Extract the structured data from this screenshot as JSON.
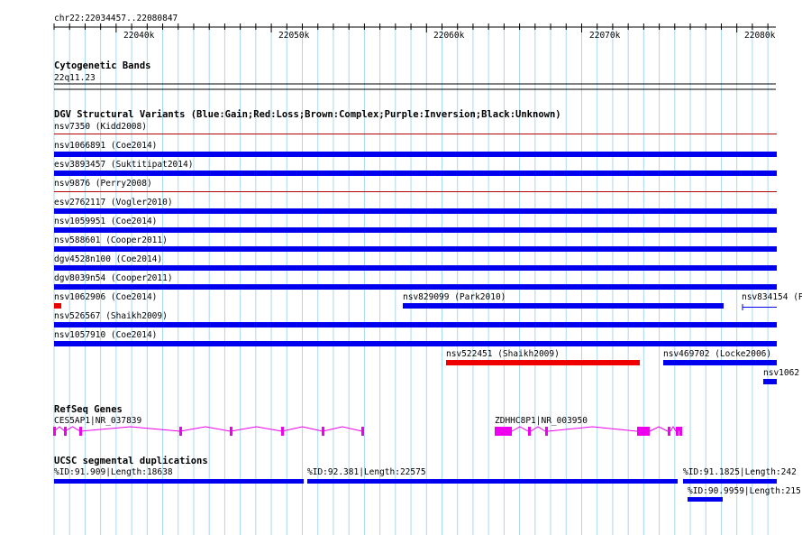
{
  "region": "chr22:22034457..22080847",
  "ruler": {
    "ticks": [
      "22040k",
      "22050k",
      "22060k",
      "22070k",
      "22080k"
    ]
  },
  "colors": {
    "gain": "#0000ee",
    "loss": "#ee0000",
    "refseq": "#ee00ee",
    "segdup": "#0000ee",
    "gridline": "#a8d8ee"
  },
  "tracks": {
    "cyto": {
      "title": "Cytogenetic Bands",
      "band": "22q11.23"
    },
    "dgv": {
      "title": "DGV Structural Variants (Blue:Gain;Red:Loss;Brown:Complex;Purple:Inversion;Black:Unknown)",
      "features": [
        {
          "label": "nsv7350 (Kidd2008)",
          "type": "gain",
          "style": "line"
        },
        {
          "label": "nsv1066891 (Coe2014)",
          "type": "gain",
          "style": "bar"
        },
        {
          "label": "esv3893457 (Suktitipat2014)",
          "type": "gain",
          "style": "bar"
        },
        {
          "label": "nsv9876 (Perry2008)",
          "type": "gain",
          "style": "line"
        },
        {
          "label": "esv2762117 (Vogler2010)",
          "type": "gain",
          "style": "bar"
        },
        {
          "label": "nsv1059951 (Coe2014)",
          "type": "gain",
          "style": "bar"
        },
        {
          "label": "nsv588601 (Cooper2011)",
          "type": "gain",
          "style": "bar"
        },
        {
          "label": "dgv4528n100 (Coe2014)",
          "type": "gain",
          "style": "bar"
        },
        {
          "label": "dgv8039n54 (Cooper2011)",
          "type": "gain",
          "style": "bar"
        },
        {
          "label": "nsv1062906 (Coe2014)",
          "type": "loss",
          "style": "bar"
        },
        {
          "label": "nsv829099 (Park2010)",
          "type": "gain",
          "style": "bar"
        },
        {
          "label": "nsv834154 (P",
          "type": "gain",
          "style": "line"
        },
        {
          "label": "nsv526567 (Shaikh2009)",
          "type": "gain",
          "style": "bar"
        },
        {
          "label": "nsv1057910 (Coe2014)",
          "type": "gain",
          "style": "bar"
        },
        {
          "label": "nsv522451 (Shaikh2009)",
          "type": "loss",
          "style": "bar"
        },
        {
          "label": "nsv469702 (Locke2006)",
          "type": "gain",
          "style": "bar"
        },
        {
          "label": "nsv1062",
          "type": "gain",
          "style": "bar"
        }
      ]
    },
    "refseq": {
      "title": "RefSeq Genes",
      "genes": [
        {
          "label": "CES5AP1|NR_037839"
        },
        {
          "label": "ZDHHC8P1|NR_003950"
        }
      ]
    },
    "segdup": {
      "title": "UCSC segmental duplications",
      "features": [
        {
          "label": "%ID:91.909|Length:18638"
        },
        {
          "label": "%ID:92.381|Length:22575"
        },
        {
          "label": "%ID:91.1825|Length:242"
        },
        {
          "label": "%ID:90.9959|Length:215"
        }
      ]
    }
  }
}
